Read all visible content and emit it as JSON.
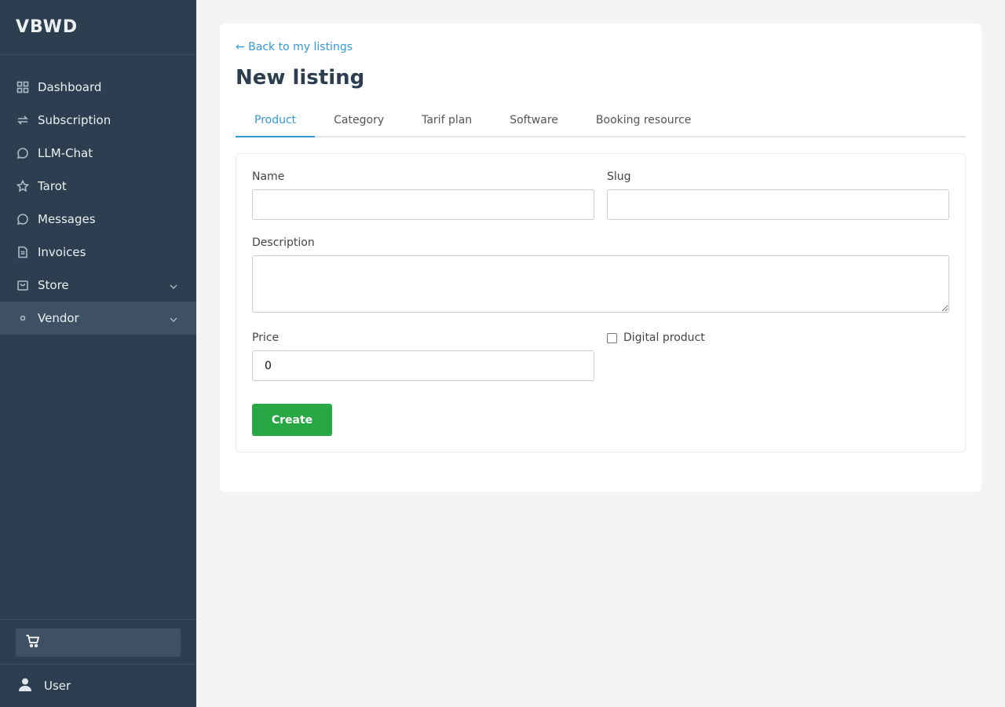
{
  "app": {
    "brand": "VBWD"
  },
  "sidebar": {
    "items": [
      {
        "label": "Dashboard",
        "icon": "grid-icon"
      },
      {
        "label": "Subscription",
        "icon": "repeat-icon"
      },
      {
        "label": "LLM-Chat",
        "icon": "chat-icon"
      },
      {
        "label": "Tarot",
        "icon": "star-icon"
      },
      {
        "label": "Messages",
        "icon": "message-icon"
      },
      {
        "label": "Invoices",
        "icon": "document-icon"
      },
      {
        "label": "Store",
        "icon": "bag-icon",
        "expandable": true
      },
      {
        "label": "Vendor",
        "icon": "dot-icon",
        "expandable": true,
        "active": true
      }
    ],
    "user_label": "User"
  },
  "main": {
    "back_link": "← Back to my listings",
    "title": "New listing",
    "tabs": [
      {
        "label": "Product",
        "active": true
      },
      {
        "label": "Category"
      },
      {
        "label": "Tarif plan"
      },
      {
        "label": "Software"
      },
      {
        "label": "Booking resource"
      }
    ],
    "form": {
      "name_label": "Name",
      "name_value": "",
      "slug_label": "Slug",
      "slug_value": "",
      "description_label": "Description",
      "description_value": "",
      "price_label": "Price",
      "price_value": "0",
      "digital_label": "Digital product",
      "digital_checked": false,
      "create_label": "Create"
    }
  },
  "colors": {
    "sidebar_bg": "#2c3e50",
    "accent": "#3498db",
    "create_button": "#28a745"
  }
}
